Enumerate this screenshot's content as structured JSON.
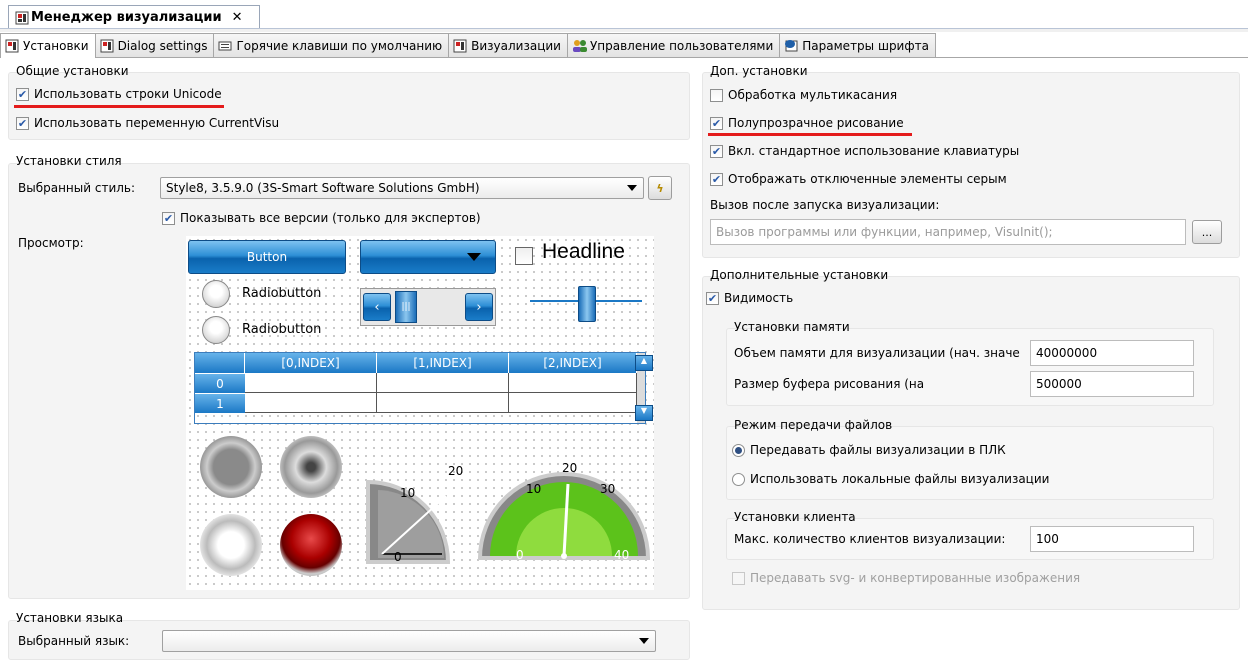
{
  "window_tab": {
    "title": "Менеджер визуализации",
    "close": "✕"
  },
  "tabs": [
    {
      "label": "Установки",
      "active": true
    },
    {
      "label": "Dialog settings"
    },
    {
      "label": "Горячие клавиши по умолчанию"
    },
    {
      "label": "Визуализации"
    },
    {
      "label": "Управление пользователями"
    },
    {
      "label": "Параметры шрифта"
    }
  ],
  "general": {
    "title": "Общие установки",
    "unicode": "Использовать строки Unicode",
    "current_visu": "Использовать переменную CurrentVisu"
  },
  "style": {
    "title": "Установки стиля",
    "selected_label": "Выбранный стиль:",
    "selected_value": "Style8, 3.5.9.0 (3S-Smart Software Solutions GmbH)",
    "show_all": "Показывать все версии (только для экспертов)",
    "preview_label": "Просмотр:"
  },
  "preview": {
    "button": "Button",
    "headline": "Headline",
    "radio1": "Radiobutton",
    "radio2": "Radiobutton",
    "table_headers": [
      "[0,INDEX]",
      "[1,INDEX]",
      "[2,INDEX]"
    ],
    "table_rows": [
      "0",
      "1"
    ],
    "gauge1_labels": [
      "20",
      "10",
      "0"
    ],
    "gauge2_labels": [
      "20",
      "10",
      "30",
      "0",
      "40"
    ]
  },
  "language": {
    "title": "Установки языка",
    "selected_label": "Выбранный язык:",
    "selected_value": ""
  },
  "extra": {
    "title": "Доп. установки",
    "multitouch": "Обработка мультикасания",
    "semitransparent": "Полупрозрачное рисование",
    "keyboard": "Вкл. стандартное использование клавиатуры",
    "grayed": "Отображать отключенные элементы серым",
    "call_after_label": "Вызов после запуска визуализации:",
    "call_after_placeholder": "Вызов программы или функции, например, VisuInit();",
    "browse": "..."
  },
  "additional": {
    "title": "Дополнительные установки",
    "visibility": "Видимость",
    "memory": {
      "title": "Установки памяти",
      "size_label": "Объем памяти для визуализации (нач. значе",
      "size_value": "40000000",
      "buffer_label": "Размер буфера рисования (на",
      "buffer_value": "500000"
    },
    "transfer": {
      "title": "Режим передачи файлов",
      "option1": "Передавать файлы визуализации в ПЛК",
      "option2": "Использовать локальные файлы визуализации"
    },
    "client": {
      "title": "Установки клиента",
      "max_label": "Макс. количество клиентов визуализации:",
      "max_value": "100"
    },
    "svg": "Передавать svg- и конвертированные изображения"
  },
  "colors": {
    "highlight": "#e41b1b",
    "accent_blue": "#1b78c5",
    "gauge_green": "#5cc21b"
  }
}
